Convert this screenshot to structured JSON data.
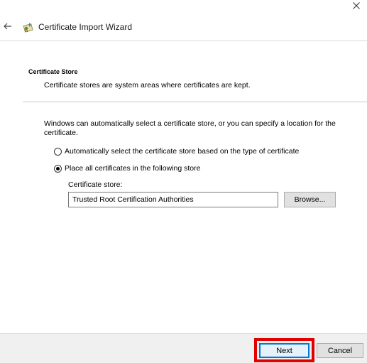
{
  "window": {
    "title": "Certificate Import Wizard",
    "close_icon": "close-icon",
    "back_icon": "back-arrow-icon",
    "app_icon": "certificate-wizard-icon"
  },
  "section": {
    "heading": "Certificate Store",
    "description": "Certificate stores are system areas where certificates are kept."
  },
  "content": {
    "intro": "Windows can automatically select a certificate store, or you can specify a location for the certificate.",
    "options": [
      {
        "label": "Automatically select the certificate store based on the type of certificate",
        "selected": false
      },
      {
        "label": "Place all certificates in the following store",
        "selected": true
      }
    ],
    "store_label": "Certificate store:",
    "store_value": "Trusted Root Certification Authorities",
    "browse_label": "Browse..."
  },
  "footer": {
    "next_label": "Next",
    "cancel_label": "Cancel"
  },
  "colors": {
    "highlight": "#e00000",
    "focus_border": "#0078d7",
    "footer_bg": "#f0f0f0"
  }
}
